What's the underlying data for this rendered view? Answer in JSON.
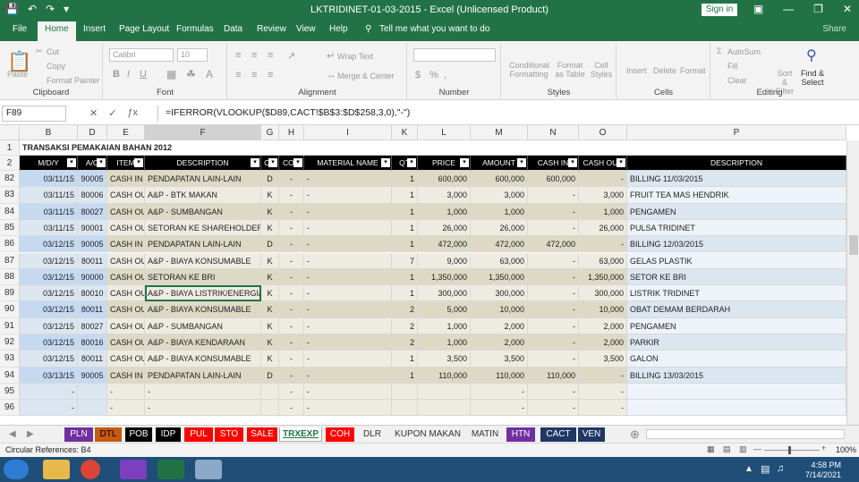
{
  "window": {
    "title": "LKTRIDINET-01-03-2015  -  Excel (Unlicensed Product)",
    "signin": "Sign in"
  },
  "ribbon_tabs": [
    "File",
    "Home",
    "Insert",
    "Page Layout",
    "Formulas",
    "Data",
    "Review",
    "View",
    "Help"
  ],
  "tell_me": "Tell me what you want to do",
  "share": "Share",
  "ribbon": {
    "clipboard": {
      "label": "Clipboard",
      "paste": "Paste",
      "cut": "Cut",
      "copy": "Copy",
      "painter": "Format Painter"
    },
    "font": {
      "label": "Font",
      "name": "Calibri",
      "size": "10"
    },
    "alignment": {
      "label": "Alignment",
      "wrap": "Wrap Text",
      "merge": "Merge & Center"
    },
    "number": {
      "label": "Number"
    },
    "styles": {
      "label": "Styles",
      "cond": "Conditional Formatting",
      "table": "Format as Table",
      "cellstyles": "Cell Styles"
    },
    "cells": {
      "label": "Cells",
      "insert": "Insert",
      "delete": "Delete",
      "format": "Format"
    },
    "editing": {
      "label": "Editing",
      "autosum": "AutoSum",
      "fill": "Fill",
      "clear": "Clear",
      "sort": "Sort & Filter",
      "find": "Find & Select"
    }
  },
  "formula_bar": {
    "name_box": "F89",
    "formula": "=IFERROR(VLOOKUP($D89,CACT!$B$3:$D$258,3,0),\"-\")"
  },
  "columns": [
    "B",
    "D",
    "E",
    "F",
    "G",
    "H",
    "I",
    "K",
    "L",
    "M",
    "N",
    "O",
    "P"
  ],
  "sheet_title": "TRANSAKSI PEMAKAIAN BAHAN 2012",
  "headers": [
    "M/D/Y",
    "A/C",
    "ITEM",
    "DESCRIPTION",
    "CO",
    "COH",
    "MATERIAL NAME",
    "QT",
    "PRICE",
    "AMOUNT",
    "CASH IN",
    "CASH OUT",
    "DESCRIPTION"
  ],
  "rows": [
    {
      "n": "82",
      "d": "03/11/15",
      "ac": "90005",
      "item": "CASH IN",
      "desc": "PENDAPATAN LAIN-LAIN",
      "co": "D",
      "coh": "-",
      "mat": "-",
      "qt": "1",
      "price": "600,000",
      "amount": "600,000",
      "cin": "600,000",
      "cout": "-",
      "note": "BILLING 11/03/2015"
    },
    {
      "n": "83",
      "d": "03/11/15",
      "ac": "80006",
      "item": "CASH OUT",
      "desc": "A&P - BTK MAKAN",
      "co": "K",
      "coh": "-",
      "mat": "-",
      "qt": "1",
      "price": "3,000",
      "amount": "3,000",
      "cin": "-",
      "cout": "3,000",
      "note": "FRUIT TEA MAS HENDRIK"
    },
    {
      "n": "84",
      "d": "03/11/15",
      "ac": "80027",
      "item": "CASH OUT",
      "desc": "A&P - SUMBANGAN",
      "co": "K",
      "coh": "-",
      "mat": "-",
      "qt": "1",
      "price": "1,000",
      "amount": "1,000",
      "cin": "-",
      "cout": "1,000",
      "note": "PENGAMEN"
    },
    {
      "n": "85",
      "d": "03/11/15",
      "ac": "90001",
      "item": "CASH OUT",
      "desc": "SETORAN KE SHAREHOLDER",
      "co": "K",
      "coh": "-",
      "mat": "-",
      "qt": "1",
      "price": "26,000",
      "amount": "26,000",
      "cin": "-",
      "cout": "26,000",
      "note": "PULSA TRIDINET"
    },
    {
      "n": "86",
      "d": "03/12/15",
      "ac": "90005",
      "item": "CASH IN",
      "desc": "PENDAPATAN LAIN-LAIN",
      "co": "D",
      "coh": "-",
      "mat": "-",
      "qt": "1",
      "price": "472,000",
      "amount": "472,000",
      "cin": "472,000",
      "cout": "-",
      "note": "BILLING 12/03/2015"
    },
    {
      "n": "87",
      "d": "03/12/15",
      "ac": "80011",
      "item": "CASH OUT",
      "desc": "A&P - BIAYA KONSUMABLE",
      "co": "K",
      "coh": "-",
      "mat": "-",
      "qt": "7",
      "price": "9,000",
      "amount": "63,000",
      "cin": "-",
      "cout": "63,000",
      "note": "GELAS PLASTIK"
    },
    {
      "n": "88",
      "d": "03/12/15",
      "ac": "90000",
      "item": "CASH OUT",
      "desc": "SETORAN KE BRI",
      "co": "K",
      "coh": "-",
      "mat": "-",
      "qt": "1",
      "price": "1,350,000",
      "amount": "1,350,000",
      "cin": "-",
      "cout": "1,350,000",
      "note": "SETOR KE BRI"
    },
    {
      "n": "89",
      "d": "03/12/15",
      "ac": "80010",
      "item": "CASH OUT",
      "desc": "A&P - BIAYA LISTRIK/ENERGI/AIR",
      "co": "K",
      "coh": "-",
      "mat": "-",
      "qt": "1",
      "price": "300,000",
      "amount": "300,000",
      "cin": "-",
      "cout": "300,000",
      "note": "LISTRIK TRIDINET"
    },
    {
      "n": "90",
      "d": "03/12/15",
      "ac": "80011",
      "item": "CASH OUT",
      "desc": "A&P - BIAYA KONSUMABLE",
      "co": "K",
      "coh": "-",
      "mat": "-",
      "qt": "2",
      "price": "5,000",
      "amount": "10,000",
      "cin": "-",
      "cout": "10,000",
      "note": "OBAT DEMAM BERDARAH"
    },
    {
      "n": "91",
      "d": "03/12/15",
      "ac": "80027",
      "item": "CASH OUT",
      "desc": "A&P - SUMBANGAN",
      "co": "K",
      "coh": "-",
      "mat": "-",
      "qt": "2",
      "price": "1,000",
      "amount": "2,000",
      "cin": "-",
      "cout": "2,000",
      "note": "PENGAMEN"
    },
    {
      "n": "92",
      "d": "03/12/15",
      "ac": "80016",
      "item": "CASH OUT",
      "desc": "A&P - BIAYA KENDARAAN",
      "co": "K",
      "coh": "-",
      "mat": "-",
      "qt": "2",
      "price": "1,000",
      "amount": "2,000",
      "cin": "-",
      "cout": "2,000",
      "note": "PARKIR"
    },
    {
      "n": "93",
      "d": "03/12/15",
      "ac": "80011",
      "item": "CASH OUT",
      "desc": "A&P - BIAYA KONSUMABLE",
      "co": "K",
      "coh": "-",
      "mat": "-",
      "qt": "1",
      "price": "3,500",
      "amount": "3,500",
      "cin": "-",
      "cout": "3,500",
      "note": "GALON"
    },
    {
      "n": "94",
      "d": "03/13/15",
      "ac": "90005",
      "item": "CASH IN",
      "desc": "PENDAPATAN LAIN-LAIN",
      "co": "D",
      "coh": "-",
      "mat": "-",
      "qt": "1",
      "price": "110,000",
      "amount": "110,000",
      "cin": "110,000",
      "cout": "-",
      "note": "BILLING 13/03/2015"
    },
    {
      "n": "95",
      "d": "-",
      "ac": "",
      "item": "-",
      "desc": "-",
      "co": "",
      "coh": "-",
      "mat": "-",
      "qt": "",
      "price": "",
      "amount": "-",
      "cin": "-",
      "cout": "-",
      "note": ""
    },
    {
      "n": "96",
      "d": "-",
      "ac": "",
      "item": "-",
      "desc": "-",
      "co": "",
      "coh": "-",
      "mat": "-",
      "qt": "",
      "price": "",
      "amount": "-",
      "cin": "-",
      "cout": "-",
      "note": ""
    }
  ],
  "sheets": [
    {
      "name": "PLN",
      "bg": "#7030a0",
      "fg": "#ffffff"
    },
    {
      "name": "DTL",
      "bg": "#c55a11",
      "fg": "#000000"
    },
    {
      "name": "POB",
      "bg": "#000000",
      "fg": "#ffffff"
    },
    {
      "name": "IDP",
      "bg": "#000000",
      "fg": "#ffffff"
    },
    {
      "name": "PUL",
      "bg": "#ff0000",
      "fg": "#ffffff"
    },
    {
      "name": "STO",
      "bg": "#ff0000",
      "fg": "#ffffff"
    },
    {
      "name": "SALE",
      "bg": "#ff0000",
      "fg": "#ffffff"
    },
    {
      "name": "TRXEXP",
      "bg": "#ffffff",
      "fg": "#217346"
    },
    {
      "name": "COH",
      "bg": "#ff0000",
      "fg": "#ffffff"
    },
    {
      "name": "DLR",
      "bg": "#f0f0f0",
      "fg": "#333333"
    },
    {
      "name": "KUPON MAKAN",
      "bg": "#f0f0f0",
      "fg": "#333333"
    },
    {
      "name": "MATIN",
      "bg": "#f0f0f0",
      "fg": "#333333"
    },
    {
      "name": "HTN",
      "bg": "#7030a0",
      "fg": "#ffffff"
    },
    {
      "name": "CACT",
      "bg": "#1f3864",
      "fg": "#ffffff"
    },
    {
      "name": "VEN",
      "bg": "#1f3864",
      "fg": "#ffffff"
    }
  ],
  "status": {
    "left": "Circular References: B4",
    "zoom": "100%"
  },
  "clock": {
    "time": "4:58 PM",
    "date": "7/14/2021"
  }
}
